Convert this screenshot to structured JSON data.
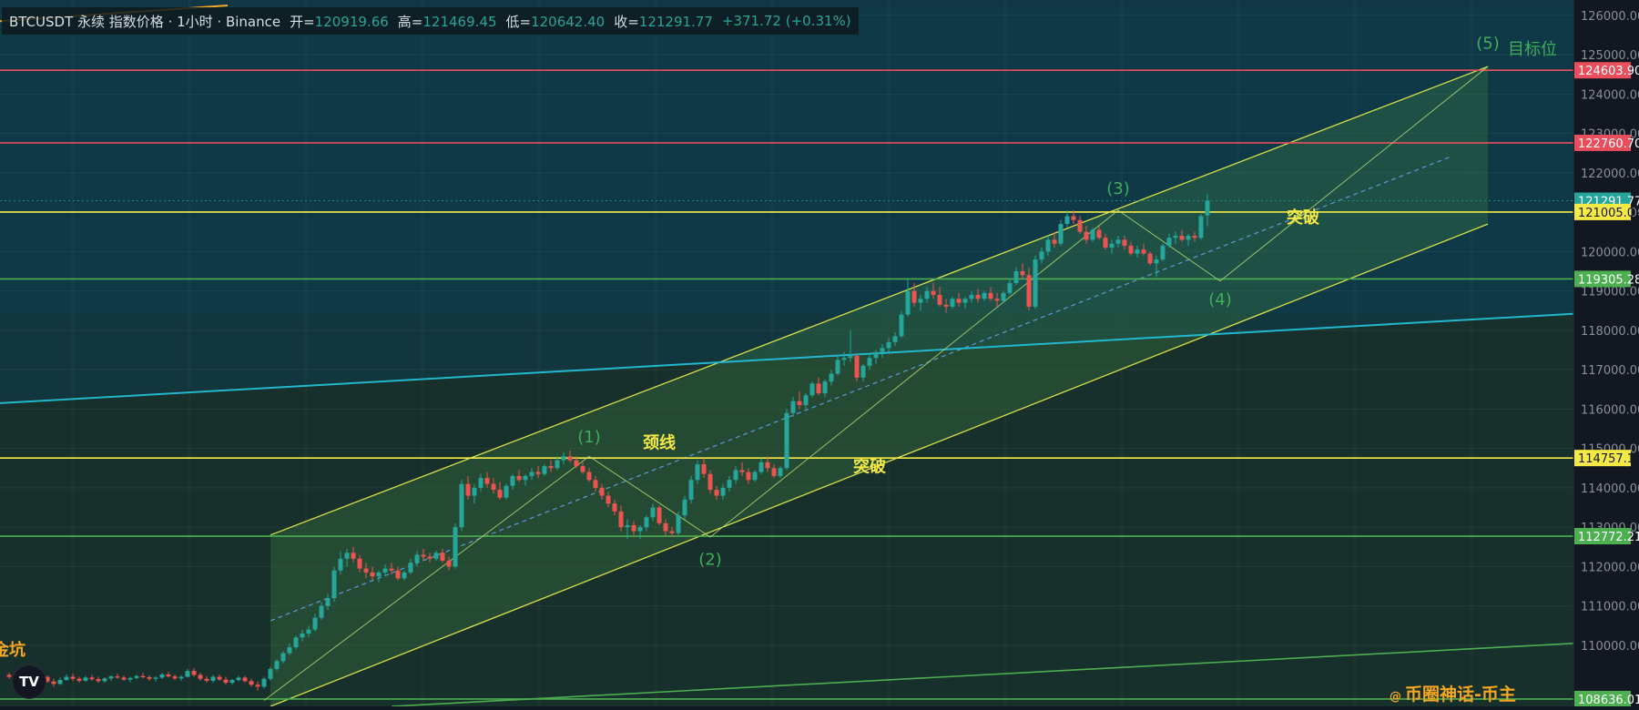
{
  "header": {
    "symbol": "BTCUSDT 永续 指数价格 · 1小时 · Binance",
    "open_label": "开=",
    "open": "120919.66",
    "high_label": "高=",
    "high": "121469.45",
    "low_label": "低=",
    "low": "120642.40",
    "close_label": "收=",
    "close": "121291.77",
    "change": "+371.72 (+0.31%)"
  },
  "logo_text": "TV",
  "watermark": {
    "at": "@",
    "text": "币圈神话-币主"
  },
  "colors": {
    "up": "#26a69a",
    "down": "#ef5350",
    "yellow": "#f5ea45",
    "green_line": "#4caf50",
    "red_line": "#e84e5c",
    "cyan_line": "#22b8cf",
    "orange": "#f5a623",
    "channel": "#d8e04a",
    "label_green": "#3fae5a",
    "label_yellow": "#f5ea45"
  },
  "chart_data": {
    "type": "candlestick",
    "timeframe": "1h",
    "y_ticks": [
      126000,
      125000,
      124000,
      123000,
      122000,
      121000,
      120000,
      119000,
      118000,
      117000,
      116000,
      115000,
      114000,
      113000,
      112000,
      111000,
      110000
    ],
    "ylim": [
      108450,
      126250
    ],
    "price_levels": [
      {
        "label": "124603.90",
        "value": 124603.9,
        "color": "#e84e5c"
      },
      {
        "label": "122760.70",
        "value": 122760.7,
        "color": "#e84e5c"
      },
      {
        "label": "121291.77",
        "value": 121291.77,
        "color": "#26a69a",
        "dotted": true
      },
      {
        "label": "121005.02",
        "value": 121005.02,
        "color": "#f5ea45"
      },
      {
        "label": "119305.28",
        "value": 119305.28,
        "color": "#4caf50"
      },
      {
        "label": "114757.11",
        "value": 114757.11,
        "color": "#f5ea45"
      },
      {
        "label": "112772.21",
        "value": 112772.21,
        "color": "#4caf50"
      },
      {
        "label": "108636.01",
        "value": 108636.01,
        "color": "#4caf50"
      }
    ],
    "annotations": [
      {
        "text": "(1)",
        "color": "#3fae5a",
        "bar": 91,
        "price": 115150
      },
      {
        "text": "颈线",
        "color": "#f5ea45",
        "bar": 102,
        "price": 115000
      },
      {
        "text": "(2)",
        "color": "#3fae5a",
        "bar": 110,
        "price": 112050
      },
      {
        "text": "突破",
        "color": "#f5ea45",
        "bar": 135,
        "price": 114400
      },
      {
        "text": "(3)",
        "color": "#3fae5a",
        "bar": 174,
        "price": 121460
      },
      {
        "text": "(4)",
        "color": "#3fae5a",
        "bar": 190,
        "price": 118650
      },
      {
        "text": "突破",
        "color": "#f5ea45",
        "bar": 203,
        "price": 120730
      },
      {
        "text": "(5)",
        "color": "#3fae5a",
        "bar": 232,
        "price": 125150
      },
      {
        "text": "目标位",
        "color": "#3fae5a",
        "bar": 239,
        "price": 125000
      },
      {
        "text": "金坑",
        "color": "#f5a623",
        "bar": 0,
        "price": 109750
      }
    ],
    "candles": [
      [
        109250,
        109300,
        109150,
        109200
      ],
      [
        109200,
        109260,
        109100,
        109150
      ],
      [
        109150,
        109300,
        109100,
        109240
      ],
      [
        109240,
        109280,
        109050,
        109100
      ],
      [
        109100,
        109200,
        109000,
        109160
      ],
      [
        109160,
        109250,
        109120,
        109200
      ],
      [
        109200,
        109230,
        109050,
        109080
      ],
      [
        109080,
        109150,
        108950,
        109020
      ],
      [
        109020,
        109180,
        108990,
        109120
      ],
      [
        109120,
        109260,
        109100,
        109200
      ],
      [
        109200,
        109280,
        109100,
        109150
      ],
      [
        109150,
        109200,
        109050,
        109100
      ],
      [
        109100,
        109220,
        109080,
        109180
      ],
      [
        109180,
        109250,
        109100,
        109140
      ],
      [
        109140,
        109200,
        109050,
        109090
      ],
      [
        109090,
        109190,
        109050,
        109160
      ],
      [
        109160,
        109240,
        109100,
        109210
      ],
      [
        109210,
        109280,
        109150,
        109180
      ],
      [
        109180,
        109230,
        109100,
        109130
      ],
      [
        109130,
        109200,
        109060,
        109170
      ],
      [
        109170,
        109260,
        109140,
        109220
      ],
      [
        109220,
        109300,
        109160,
        109190
      ],
      [
        109190,
        109240,
        109100,
        109150
      ],
      [
        109150,
        109220,
        109080,
        109180
      ],
      [
        109180,
        109300,
        109150,
        109260
      ],
      [
        109260,
        109320,
        109180,
        109210
      ],
      [
        109210,
        109260,
        109120,
        109160
      ],
      [
        109160,
        109240,
        109100,
        109200
      ],
      [
        109200,
        109400,
        109180,
        109350
      ],
      [
        109350,
        109420,
        109200,
        109250
      ],
      [
        109250,
        109300,
        109100,
        109150
      ],
      [
        109150,
        109220,
        109050,
        109100
      ],
      [
        109100,
        109250,
        109050,
        109200
      ],
      [
        109200,
        109260,
        109100,
        109130
      ],
      [
        109130,
        109200,
        109000,
        109050
      ],
      [
        109050,
        109150,
        109000,
        109120
      ],
      [
        109120,
        109220,
        109080,
        109180
      ],
      [
        109180,
        109230,
        109060,
        109090
      ],
      [
        109090,
        109150,
        108950,
        109000
      ],
      [
        109000,
        109080,
        108850,
        108950
      ],
      [
        108950,
        109200,
        108900,
        109150
      ],
      [
        109150,
        109450,
        109100,
        109400
      ],
      [
        109400,
        109650,
        109350,
        109600
      ],
      [
        109600,
        109850,
        109550,
        109800
      ],
      [
        109800,
        110050,
        109750,
        109950
      ],
      [
        109950,
        110250,
        109900,
        110200
      ],
      [
        110200,
        110400,
        110100,
        110300
      ],
      [
        110300,
        110500,
        110200,
        110400
      ],
      [
        110400,
        110800,
        110350,
        110700
      ],
      [
        110700,
        111100,
        110650,
        111000
      ],
      [
        111000,
        111300,
        110900,
        111200
      ],
      [
        111200,
        112000,
        111100,
        111900
      ],
      [
        111900,
        112400,
        111800,
        112200
      ],
      [
        112200,
        112450,
        112000,
        112350
      ],
      [
        112350,
        112500,
        112100,
        112200
      ],
      [
        112200,
        112300,
        111850,
        111950
      ],
      [
        111950,
        112100,
        111700,
        111850
      ],
      [
        111850,
        112000,
        111650,
        111750
      ],
      [
        111750,
        111900,
        111600,
        111850
      ],
      [
        111850,
        112050,
        111750,
        111950
      ],
      [
        111950,
        112100,
        111800,
        111900
      ],
      [
        111900,
        112000,
        111650,
        111700
      ],
      [
        111700,
        111900,
        111650,
        111850
      ],
      [
        111850,
        112200,
        111800,
        112100
      ],
      [
        112100,
        112400,
        112000,
        112300
      ],
      [
        112300,
        112450,
        112150,
        112250
      ],
      [
        112250,
        112350,
        112100,
        112200
      ],
      [
        112200,
        112400,
        112150,
        112350
      ],
      [
        112350,
        112450,
        112100,
        112150
      ],
      [
        112150,
        112250,
        111900,
        112000
      ],
      [
        112000,
        113100,
        111950,
        113000
      ],
      [
        113000,
        114200,
        112900,
        114100
      ],
      [
        114100,
        114300,
        113700,
        113800
      ],
      [
        113800,
        114100,
        113600,
        114000
      ],
      [
        114000,
        114350,
        113900,
        114250
      ],
      [
        114250,
        114400,
        114000,
        114100
      ],
      [
        114100,
        114250,
        113850,
        113950
      ],
      [
        113950,
        114150,
        113700,
        113750
      ],
      [
        113750,
        114100,
        113700,
        114050
      ],
      [
        114050,
        114350,
        113950,
        114300
      ],
      [
        114300,
        114450,
        114150,
        114200
      ],
      [
        114200,
        114350,
        114050,
        114300
      ],
      [
        114300,
        114500,
        114200,
        114400
      ],
      [
        114400,
        114550,
        114250,
        114350
      ],
      [
        114350,
        114600,
        114300,
        114550
      ],
      [
        114550,
        114700,
        114400,
        114500
      ],
      [
        114500,
        114800,
        114450,
        114700
      ],
      [
        114700,
        114900,
        114600,
        114800
      ],
      [
        114800,
        114950,
        114650,
        114700
      ],
      [
        114700,
        114800,
        114500,
        114550
      ],
      [
        114550,
        114650,
        114350,
        114400
      ],
      [
        114400,
        114500,
        114150,
        114200
      ],
      [
        114200,
        114300,
        113900,
        114000
      ],
      [
        114000,
        114100,
        113700,
        113800
      ],
      [
        113800,
        113900,
        113500,
        113600
      ],
      [
        113600,
        113700,
        113300,
        113400
      ],
      [
        113400,
        113550,
        112900,
        113000
      ],
      [
        113000,
        113200,
        112700,
        113050
      ],
      [
        113050,
        113150,
        112800,
        112900
      ],
      [
        112900,
        113050,
        112700,
        113000
      ],
      [
        113000,
        113300,
        112900,
        113250
      ],
      [
        113250,
        113600,
        113150,
        113500
      ],
      [
        113500,
        113550,
        113050,
        113100
      ],
      [
        113100,
        113200,
        112800,
        112900
      ],
      [
        112900,
        113000,
        112750,
        112850
      ],
      [
        112850,
        113400,
        112800,
        113300
      ],
      [
        113300,
        113800,
        113200,
        113700
      ],
      [
        113700,
        114300,
        113600,
        114200
      ],
      [
        114200,
        114700,
        114100,
        114600
      ],
      [
        114600,
        114750,
        114250,
        114350
      ],
      [
        114350,
        114450,
        113850,
        113950
      ],
      [
        113950,
        114050,
        113700,
        113800
      ],
      [
        113800,
        114100,
        113700,
        114000
      ],
      [
        114000,
        114300,
        113900,
        114200
      ],
      [
        114200,
        114550,
        114100,
        114450
      ],
      [
        114450,
        114650,
        114300,
        114400
      ],
      [
        114400,
        114500,
        114100,
        114200
      ],
      [
        114200,
        114450,
        114150,
        114400
      ],
      [
        114400,
        114750,
        114350,
        114650
      ],
      [
        114650,
        114800,
        114400,
        114500
      ],
      [
        114500,
        114600,
        114250,
        114300
      ],
      [
        114300,
        114550,
        114250,
        114500
      ],
      [
        114500,
        116000,
        114450,
        115900
      ],
      [
        115900,
        116300,
        115800,
        116200
      ],
      [
        116200,
        116450,
        116000,
        116100
      ],
      [
        116100,
        116400,
        116000,
        116350
      ],
      [
        116350,
        116700,
        116300,
        116650
      ],
      [
        116650,
        116800,
        116350,
        116400
      ],
      [
        116400,
        116750,
        116300,
        116700
      ],
      [
        116700,
        117000,
        116600,
        116900
      ],
      [
        116900,
        117350,
        116850,
        117250
      ],
      [
        117250,
        117450,
        117100,
        117300
      ],
      [
        117300,
        118000,
        117200,
        117350
      ],
      [
        117350,
        117400,
        116700,
        116800
      ],
      [
        116800,
        117150,
        116700,
        117100
      ],
      [
        117100,
        117400,
        117000,
        117300
      ],
      [
        117300,
        117500,
        117150,
        117450
      ],
      [
        117450,
        117650,
        117300,
        117550
      ],
      [
        117550,
        117800,
        117450,
        117700
      ],
      [
        117700,
        117950,
        117600,
        117850
      ],
      [
        117850,
        118500,
        117800,
        118400
      ],
      [
        118400,
        119300,
        118350,
        119000
      ],
      [
        119000,
        119200,
        118600,
        118700
      ],
      [
        118700,
        118900,
        118500,
        118800
      ],
      [
        118800,
        119100,
        118700,
        119000
      ],
      [
        119000,
        119200,
        118800,
        118900
      ],
      [
        118900,
        119100,
        118600,
        118650
      ],
      [
        118650,
        118800,
        118450,
        118600
      ],
      [
        118600,
        118850,
        118550,
        118800
      ],
      [
        118800,
        118950,
        118600,
        118700
      ],
      [
        118700,
        118850,
        118550,
        118800
      ],
      [
        118800,
        119000,
        118700,
        118900
      ],
      [
        118900,
        119050,
        118700,
        118800
      ],
      [
        118800,
        119000,
        118750,
        118950
      ],
      [
        118950,
        119100,
        118750,
        118800
      ],
      [
        118800,
        118950,
        118600,
        118750
      ],
      [
        118750,
        119000,
        118700,
        118950
      ],
      [
        118950,
        119300,
        118900,
        119200
      ],
      [
        119200,
        119600,
        119150,
        119500
      ],
      [
        119500,
        119700,
        119300,
        119400
      ],
      [
        119400,
        119600,
        118500,
        118600
      ],
      [
        118600,
        119900,
        118550,
        119800
      ],
      [
        119800,
        120100,
        119700,
        120000
      ],
      [
        120000,
        120400,
        119900,
        120300
      ],
      [
        120300,
        120500,
        120100,
        120200
      ],
      [
        120200,
        120800,
        120150,
        120700
      ],
      [
        120700,
        121050,
        120600,
        120900
      ],
      [
        120900,
        121050,
        120700,
        120800
      ],
      [
        120800,
        120900,
        120450,
        120500
      ],
      [
        120500,
        120650,
        120200,
        120300
      ],
      [
        120300,
        120600,
        120250,
        120550
      ],
      [
        120550,
        120650,
        120300,
        120350
      ],
      [
        120350,
        120450,
        120050,
        120100
      ],
      [
        120100,
        120300,
        119950,
        120200
      ],
      [
        120200,
        120400,
        120100,
        120300
      ],
      [
        120300,
        120400,
        120050,
        120150
      ],
      [
        120150,
        120250,
        119900,
        119950
      ],
      [
        119950,
        120150,
        119850,
        120050
      ],
      [
        120050,
        120200,
        119900,
        119950
      ],
      [
        119950,
        120000,
        119650,
        119700
      ],
      [
        119700,
        119900,
        119350,
        119800
      ],
      [
        119800,
        120200,
        119750,
        120150
      ],
      [
        120150,
        120450,
        120100,
        120350
      ],
      [
        120350,
        120500,
        120200,
        120400
      ],
      [
        120400,
        120550,
        120250,
        120300
      ],
      [
        120300,
        120450,
        120150,
        120400
      ],
      [
        120400,
        120500,
        120250,
        120350
      ],
      [
        120350,
        120950,
        120300,
        120900
      ],
      [
        120920,
        121470,
        120640,
        121292
      ]
    ]
  }
}
